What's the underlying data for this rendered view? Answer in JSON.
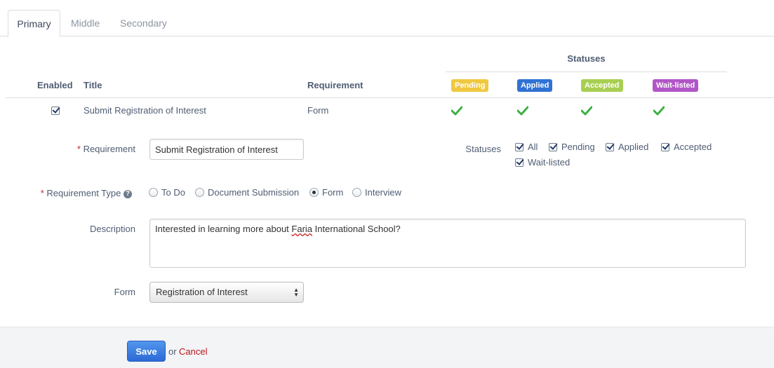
{
  "tabs": [
    {
      "label": "Primary",
      "active": true
    },
    {
      "label": "Middle",
      "active": false
    },
    {
      "label": "Secondary",
      "active": false
    }
  ],
  "table": {
    "statuses_header": "Statuses",
    "columns": {
      "enabled": "Enabled",
      "title": "Title",
      "requirement": "Requirement"
    },
    "status_badges": [
      {
        "label": "Pending",
        "color": "#f0c840"
      },
      {
        "label": "Applied",
        "color": "#2f72d4"
      },
      {
        "label": "Accepted",
        "color": "#a8cf52"
      },
      {
        "label": "Wait-listed",
        "color": "#b156c7"
      }
    ],
    "rows": [
      {
        "enabled": true,
        "title": "Submit Registration of Interest",
        "requirement": "Form",
        "statuses": [
          true,
          true,
          true,
          true
        ]
      }
    ],
    "check_color": "#3cb043"
  },
  "form": {
    "requirement_label": "Requirement",
    "requirement_value": "Submit Registration of Interest",
    "statuses_label": "Statuses",
    "status_options": [
      {
        "label": "All",
        "checked": true
      },
      {
        "label": "Pending",
        "checked": true
      },
      {
        "label": "Applied",
        "checked": true
      },
      {
        "label": "Accepted",
        "checked": true
      },
      {
        "label": "Wait-listed",
        "checked": true
      }
    ],
    "requirement_type_label": "Requirement Type",
    "required_marker": "*",
    "help_icon_glyph": "?",
    "requirement_types": [
      {
        "label": "To Do",
        "selected": false
      },
      {
        "label": "Document Submission",
        "selected": false
      },
      {
        "label": "Form",
        "selected": true
      },
      {
        "label": "Interview",
        "selected": false
      }
    ],
    "description_label": "Description",
    "description_before": "Interested in learning more about ",
    "description_misspelled": "Faria",
    "description_after": " International School?",
    "form_label": "Form",
    "form_value": "Registration of Interest"
  },
  "footer": {
    "save_label": "Save",
    "or_text": "or",
    "cancel_label": "Cancel"
  }
}
